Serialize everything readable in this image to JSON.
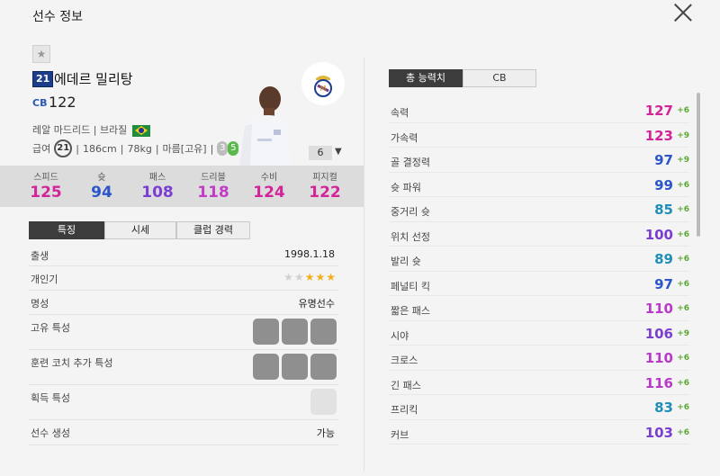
{
  "title": "선수 정보",
  "player": {
    "season_badge": "21",
    "name": "에데르 밀리탕",
    "position": "CB",
    "overall": "122",
    "club": "레알 마드리드",
    "sep": "|",
    "nation": "브라질",
    "pay_label": "급여",
    "pay": "21",
    "height": "186cm",
    "weight": "78kg",
    "body_type": "마름[고유]",
    "right_foot": "3",
    "left_foot": "5",
    "level": "6"
  },
  "summary_stats": [
    {
      "label": "스피드",
      "value": "125",
      "color": "#d4249a"
    },
    {
      "label": "슛",
      "value": "94",
      "color": "#2b55c9"
    },
    {
      "label": "패스",
      "value": "108",
      "color": "#7a3fd1"
    },
    {
      "label": "드리블",
      "value": "118",
      "color": "#c23cc8"
    },
    {
      "label": "수비",
      "value": "124",
      "color": "#d4249a"
    },
    {
      "label": "피지컬",
      "value": "122",
      "color": "#d4249a"
    }
  ],
  "tabs": [
    "특징",
    "시세",
    "클럽 경력"
  ],
  "details": {
    "birth_label": "출생",
    "birth": "1998.1.18",
    "popularity_label": "개인기",
    "fame_label": "명성",
    "fame": "유명선수",
    "unique_label": "고유 특성",
    "coach_label": "훈련 코치 추가 특성",
    "acquired_label": "획득 특성",
    "create_label": "선수 생성",
    "create": "가능"
  },
  "right_tabs": [
    "총 능력치",
    "CB"
  ],
  "attributes": [
    {
      "name": "속력",
      "value": "127",
      "bonus": "+6",
      "color": "#d4249a"
    },
    {
      "name": "가속력",
      "value": "123",
      "bonus": "+9",
      "color": "#d4249a"
    },
    {
      "name": "골 결정력",
      "value": "97",
      "bonus": "+9",
      "color": "#2b55c9"
    },
    {
      "name": "슛 파워",
      "value": "99",
      "bonus": "+6",
      "color": "#2b55c9"
    },
    {
      "name": "중거리 슛",
      "value": "85",
      "bonus": "+6",
      "color": "#1f8fb8"
    },
    {
      "name": "위치 선정",
      "value": "100",
      "bonus": "+6",
      "color": "#7a3fd1"
    },
    {
      "name": "발리 슛",
      "value": "89",
      "bonus": "+6",
      "color": "#1f8fb8"
    },
    {
      "name": "페널티 킥",
      "value": "97",
      "bonus": "+6",
      "color": "#2b55c9"
    },
    {
      "name": "짧은 패스",
      "value": "110",
      "bonus": "+6",
      "color": "#b93ac9"
    },
    {
      "name": "시야",
      "value": "106",
      "bonus": "+9",
      "color": "#7a3fd1"
    },
    {
      "name": "크로스",
      "value": "110",
      "bonus": "+6",
      "color": "#b93ac9"
    },
    {
      "name": "긴 패스",
      "value": "116",
      "bonus": "+6",
      "color": "#b93ac9"
    },
    {
      "name": "프리킥",
      "value": "83",
      "bonus": "+6",
      "color": "#1f8fb8"
    },
    {
      "name": "커브",
      "value": "103",
      "bonus": "+6",
      "color": "#7a3fd1"
    }
  ]
}
